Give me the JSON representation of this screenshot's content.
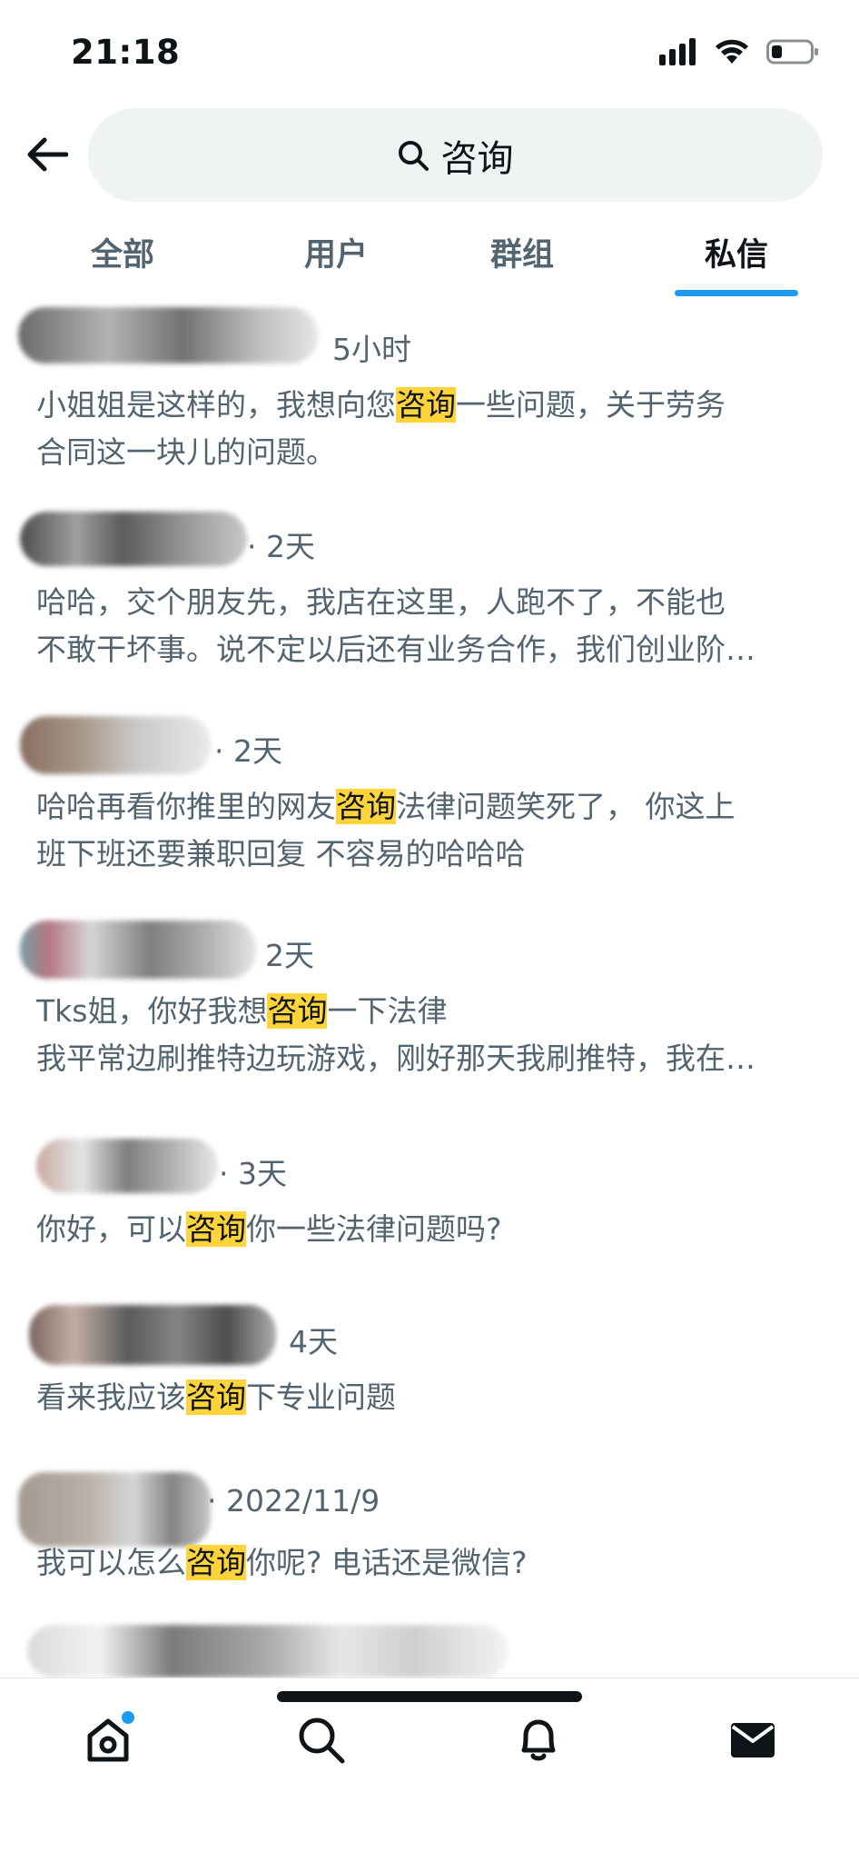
{
  "status_bar": {
    "time": "21:18"
  },
  "search": {
    "query": "咨询"
  },
  "tabs": [
    {
      "label": "全部",
      "active": false
    },
    {
      "label": "用户",
      "active": false
    },
    {
      "label": "群组",
      "active": false
    },
    {
      "label": "私信",
      "active": true
    }
  ],
  "messages": [
    {
      "time": "5小时",
      "parts": [
        [
          "小姐姐是这样的，我想向您",
          "咨询",
          "一些问题，关于劳务"
        ],
        [
          "合同这一块儿的问题。"
        ]
      ]
    },
    {
      "time": "· 2天",
      "parts": [
        [
          "哈哈，交个朋友先，我店在这里，人跑不了，不能也"
        ],
        [
          "不敢干坏事。说不定以后还有业务合作，我们创业阶…"
        ]
      ]
    },
    {
      "time": "· 2天",
      "parts": [
        [
          "哈哈再看你推里的网友",
          "咨询",
          "法律问题笑死了， 你这上"
        ],
        [
          "班下班还要兼职回复 不容易的哈哈哈"
        ]
      ]
    },
    {
      "time": "2天",
      "parts": [
        [
          "Tks姐，你好我想",
          "咨询",
          "一下法律"
        ],
        [
          "我平常边刷推特边玩游戏，刚好那天我刷推特，我在…"
        ]
      ]
    },
    {
      "time": "· 3天",
      "parts": [
        [
          "你好，可以",
          "咨询",
          "你一些法律问题吗?"
        ]
      ]
    },
    {
      "time": "4天",
      "parts": [
        [
          "看来我应该",
          "咨询",
          "下专业问题"
        ]
      ]
    },
    {
      "time": "· 2022/11/9",
      "parts": [
        [
          "我可以怎么",
          "咨询",
          "你呢? 电话还是微信?"
        ]
      ]
    }
  ],
  "nav": [
    {
      "name": "home",
      "badge": true
    },
    {
      "name": "search",
      "badge": false
    },
    {
      "name": "notifications",
      "badge": false
    },
    {
      "name": "messages",
      "badge": false
    }
  ],
  "colors": {
    "accent": "#1d9bf0",
    "highlight": "#ffd43b",
    "muted": "#536471",
    "text": "#0f1419"
  }
}
